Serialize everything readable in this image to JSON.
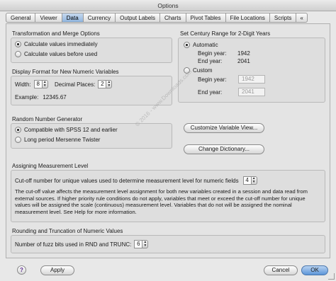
{
  "window": {
    "title": "Options"
  },
  "tabs": [
    "General",
    "Viewer",
    "Data",
    "Currency",
    "Output Labels",
    "Charts",
    "Pivot Tables",
    "File Locations",
    "Scripts",
    "«"
  ],
  "active_tab": "Data",
  "transform": {
    "title": "Transformation and Merge Options",
    "opt1": "Calculate values immediately",
    "opt2": "Calculate values before used",
    "selected": "Calculate values immediately"
  },
  "display_format": {
    "title": "Display Format for New Numeric Variables",
    "width_label": "Width:",
    "width_value": "8",
    "decimal_label": "Decimal Places:",
    "decimal_value": "2",
    "example_label": "Example:",
    "example_value": "12345.67"
  },
  "rng": {
    "title": "Random Number Generator",
    "opt1": "Compatible with SPSS 12 and earlier",
    "opt2": "Long period Mersenne Twister",
    "selected": "Compatible with SPSS 12 and earlier"
  },
  "century": {
    "title": "Set Century Range for 2-Digit Years",
    "automatic": "Automatic",
    "auto_begin_label": "Begin year:",
    "auto_begin_value": "1942",
    "auto_end_label": "End year:",
    "auto_end_value": "2041",
    "custom": "Custom",
    "custom_begin_label": "Begin year:",
    "custom_begin_value": "1942",
    "custom_end_label": "End year:",
    "custom_end_value": "2041",
    "selected": "Automatic"
  },
  "buttons": {
    "customize": "Customize Variable View...",
    "change_dictionary": "Change Dictionary...",
    "help": "?",
    "apply": "Apply",
    "cancel": "Cancel",
    "ok": "OK"
  },
  "measurement": {
    "title": "Assigning Measurement Level",
    "cutoff_label": "Cut-off number for unique values used to determine measurement level for numeric fields",
    "cutoff_value": "4",
    "description": "The cut-off value affects the measurement level assignment for both new variables created in a session and data read from external sources. If higher priority rule conditions do not apply, variables that meet or exceed the cut-off number for unique values will be assigned the scale (continuous) measurement level. Variables that do not will be assigned the nominal measurement level. See Help for more information."
  },
  "rounding": {
    "title": "Rounding and Truncation of Numeric Values",
    "fuzz_label": "Number of fuzz bits used in RND and TRUNC:",
    "fuzz_value": "6"
  },
  "watermark": "© 2016 - www.Downloads.com"
}
